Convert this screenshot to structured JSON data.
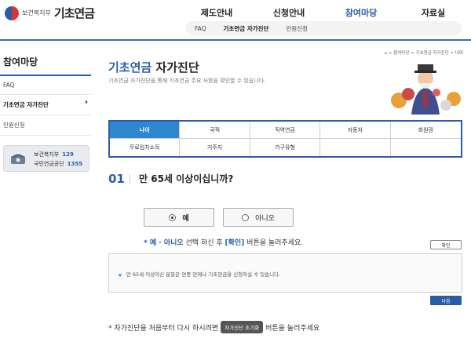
{
  "header": {
    "ministry": "보건복지부",
    "service_name": "기초연금",
    "gnb": [
      "제도안내",
      "신청안내",
      "참여마당",
      "자료실"
    ],
    "gnb_active": 2,
    "lnb": [
      "FAQ",
      "기초연금 자가진단",
      "민원신청"
    ],
    "lnb_active": 1
  },
  "sidebar": {
    "title": "참여마당",
    "items": [
      "FAQ",
      "기초연금 자가진단",
      "민원신청"
    ],
    "call": {
      "line1_label": "보건복지부",
      "line1_number": "129",
      "line2_label": "국민연금공단",
      "line2_number": "1355"
    }
  },
  "breadcrumb": {
    "path": "> 참여마당 > 기초연금 자가진단 > ",
    "current": "나이"
  },
  "page": {
    "title_highlight": "기초연금",
    "title_rest": " 자가진단",
    "description": "기초연금 자가진단을 통해 기초연금 주요 사항을 확인할 수 있습니다."
  },
  "tabs": [
    "나이",
    "국적",
    "직역연금",
    "자동차",
    "회원권",
    "무료임차소득",
    "거주지",
    "가구유형",
    ""
  ],
  "tab_active": 0,
  "question": {
    "number": "01",
    "text": "만 65세 이상이십니까?",
    "yes_label": "예",
    "no_label": "아니오"
  },
  "instruction": {
    "prefix": "* ",
    "yes": "예",
    "dot": " · ",
    "no": "아니오",
    "middle": " 선택 하신 후 ",
    "confirm": "[확인]",
    "suffix": " 버튼을 눌러주세요."
  },
  "buttons": {
    "confirm": "확인",
    "next": "다음",
    "reset": "자가진단 초기화"
  },
  "info": {
    "text": "만 65세 이상이신 분들은 연중 언제나 기초연금을 신청하실 수 있습니다."
  },
  "restart": {
    "prefix": "* 자가진단을 처음부터 다시 하시려면",
    "suffix": "버튼을 눌러주세요"
  }
}
